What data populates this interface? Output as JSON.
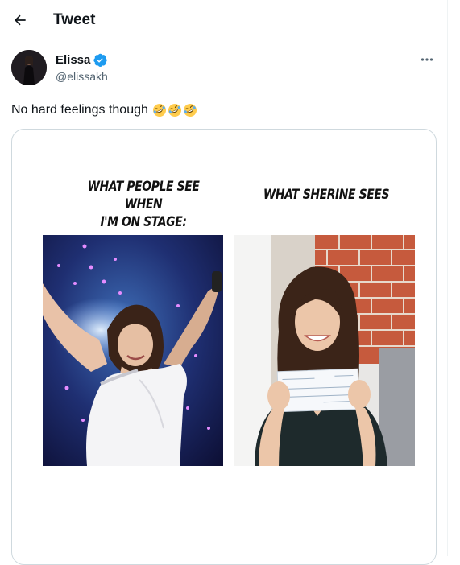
{
  "header": {
    "title": "Tweet",
    "back_icon": "arrow-left-icon"
  },
  "author": {
    "name": "Elissa",
    "handle": "@elissakh",
    "verified": true,
    "verified_color": "#1d9bf0"
  },
  "tweet": {
    "text": "No hard feelings though",
    "emojis": [
      "rolling-on-floor-laughing-emoji",
      "rolling-on-floor-laughing-emoji",
      "rolling-on-floor-laughing-emoji"
    ]
  },
  "meme": {
    "left_caption_line1": "WHAT PEOPLE SEE WHEN",
    "left_caption_line2": "I'M ON STAGE:",
    "right_caption": "WHAT SHERINE SEES"
  },
  "colors": {
    "text": "#0f1419",
    "secondary": "#536471",
    "border": "#cfd9de"
  }
}
